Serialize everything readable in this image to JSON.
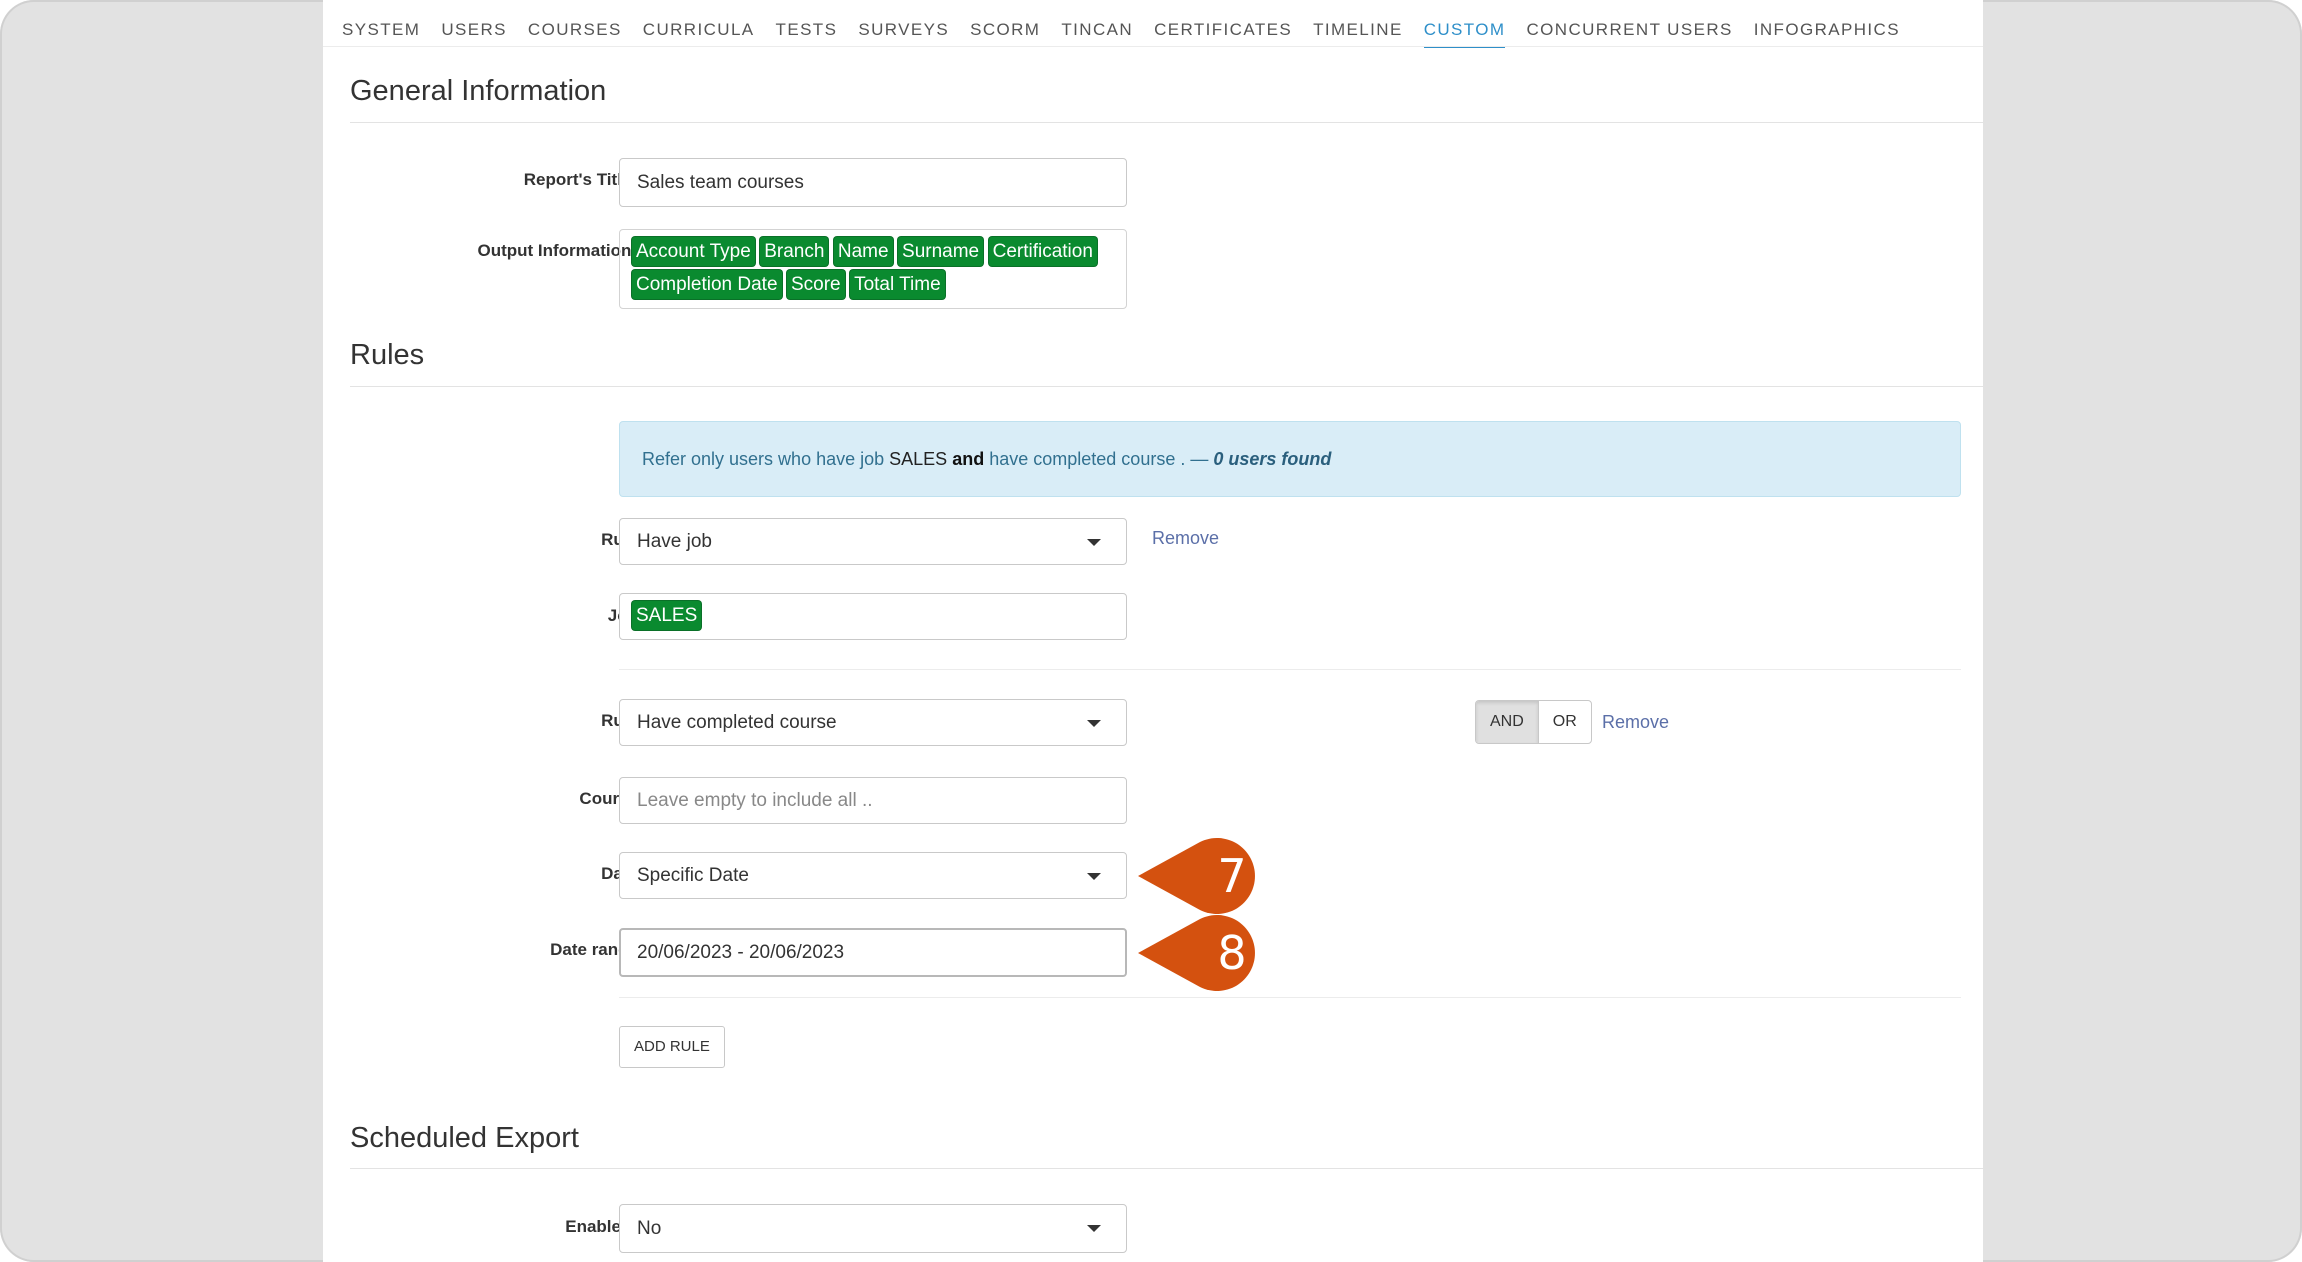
{
  "tabs": [
    "SYSTEM",
    "USERS",
    "COURSES",
    "CURRICULA",
    "TESTS",
    "SURVEYS",
    "SCORM",
    "TINCAN",
    "CERTIFICATES",
    "TIMELINE",
    "CUSTOM",
    "CONCURRENT USERS",
    "INFOGRAPHICS"
  ],
  "active_tab": "CUSTOM",
  "general": {
    "title": "General Information",
    "report_title_label": "Report's Title*",
    "report_title_value": "Sales team courses",
    "output_label": "Output Information*",
    "output_tags": [
      "Account Type",
      "Branch",
      "Name",
      "Surname",
      "Certification",
      "Completion Date",
      "Score",
      "Total Time"
    ]
  },
  "rules": {
    "title": "Rules",
    "alert": {
      "part1": "Refer only users who have job ",
      "job": "SALES",
      "and": "and",
      "part2": " have completed course . — ",
      "users_found": "0 users found"
    },
    "rule1": {
      "label": "Rule",
      "value": "Have job",
      "remove": "Remove",
      "job_label": "Job",
      "job_tag": "SALES"
    },
    "rule2": {
      "label": "Rule",
      "value": "Have completed course",
      "and_label": "AND",
      "or_label": "OR",
      "remove": "Remove",
      "course_label": "Course",
      "course_placeholder": "Leave empty to include all ..",
      "date_label": "Date",
      "date_value": "Specific Date",
      "range_label": "Date range",
      "range_value": "20/06/2023 - 20/06/2023"
    },
    "add_rule": "ADD RULE"
  },
  "scheduled": {
    "title": "Scheduled Export",
    "enabled_label": "Enabled*",
    "enabled_value": "No"
  },
  "markers": {
    "step7": "7",
    "step8": "8",
    "color": "#d4510f"
  }
}
